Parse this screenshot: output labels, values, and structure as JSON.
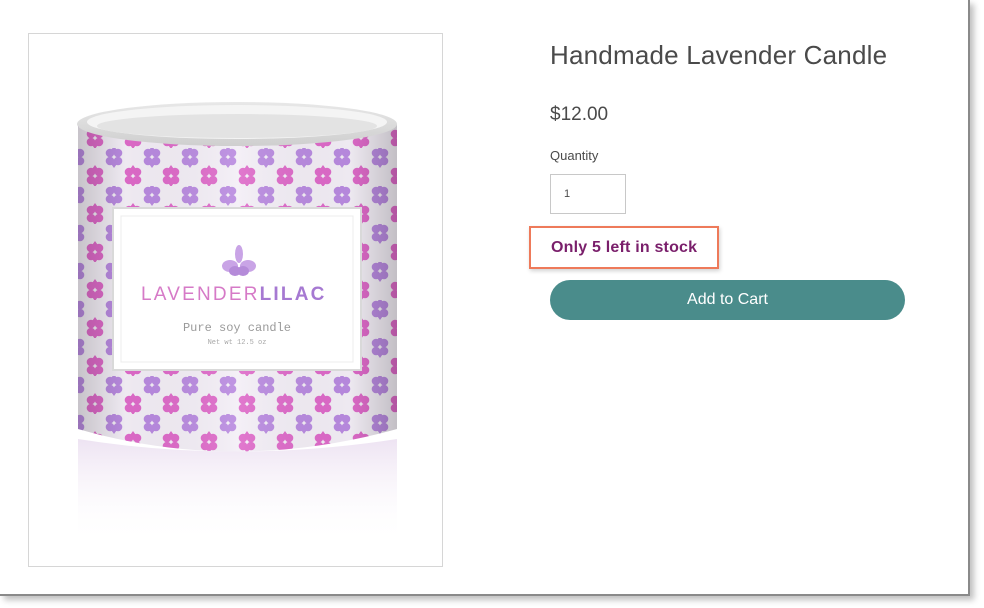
{
  "product": {
    "title": "Handmade Lavender Candle",
    "price": "$12.00",
    "quantity_label": "Quantity",
    "quantity_value": "1",
    "stock_message": "Only 5 left in stock",
    "add_to_cart_label": "Add to Cart"
  },
  "image": {
    "brand_part1": "LAVENDER",
    "brand_part2": "LILAC",
    "tagline": "Pure soy candle",
    "net_weight": "Net wt 12.5 oz"
  },
  "colors": {
    "accent_button": "#4a8c8b",
    "stock_text": "#7a1f6b",
    "highlight_border": "#ee7a5a",
    "pattern_purple": "#b77fd8",
    "pattern_pink": "#d95fc4"
  }
}
